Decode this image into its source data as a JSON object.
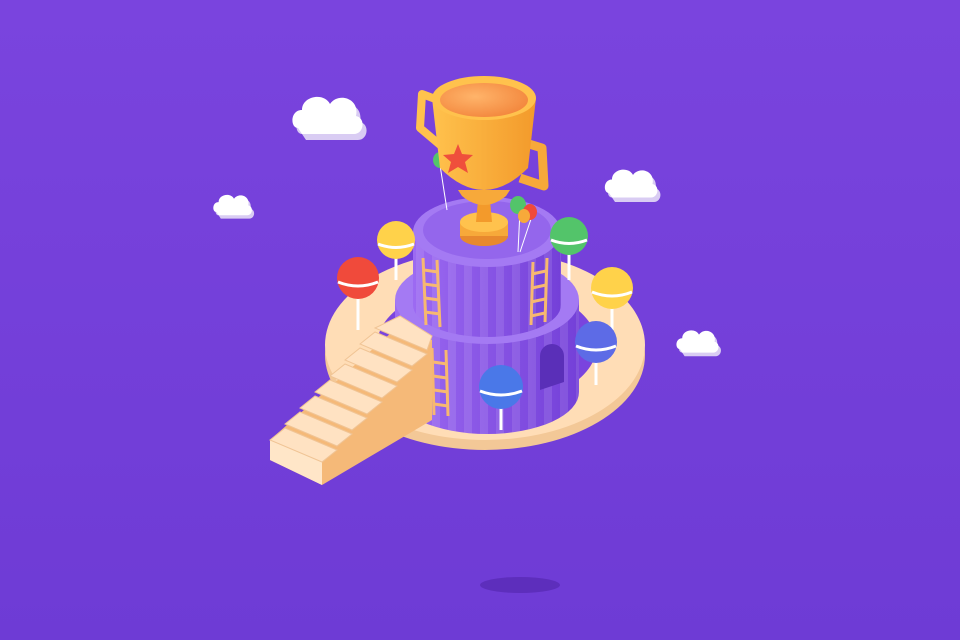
{
  "scene": {
    "background_color": "#7440DA",
    "ring_color": "#FFDDB6",
    "stair_color": "#FFE2C2",
    "tower_color": "#8B58E8",
    "trophy_color": "#F7A93A",
    "star_color": "#EF4F3C",
    "cloud_color": "#FFFFFF",
    "lollipop_colors": [
      "#F04A3B",
      "#FFD24A",
      "#53C46A",
      "#5D6BE6",
      "#4A78E8"
    ],
    "icons": [
      "cloud-icon",
      "trophy-icon",
      "star-icon",
      "lollipop-icon",
      "ladder-icon",
      "balloon-icon",
      "staircase-icon"
    ]
  }
}
